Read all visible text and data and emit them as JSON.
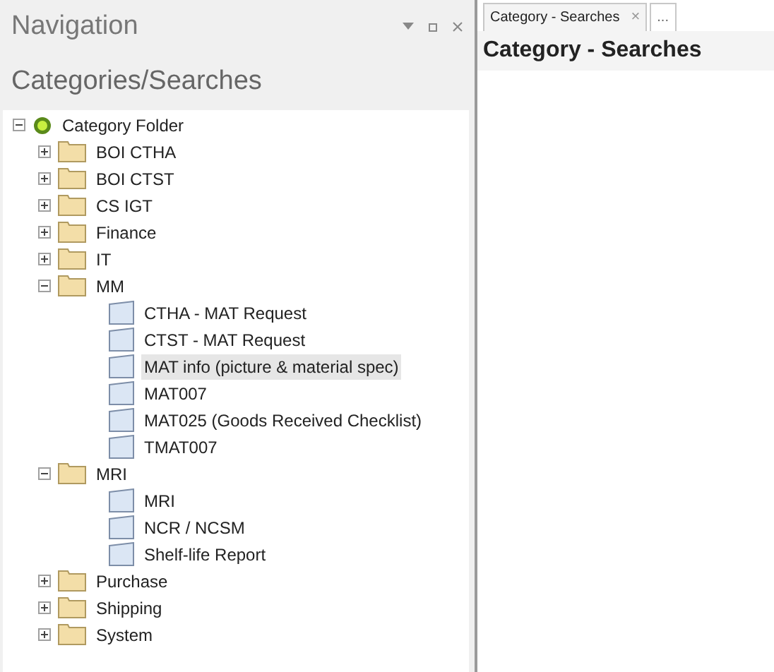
{
  "navigation": {
    "title": "Navigation",
    "subtitle": "Categories/Searches",
    "tree": [
      {
        "label": "Category Folder",
        "kind": "root",
        "expanded": true,
        "selected": false,
        "children": [
          {
            "label": "BOI CTHA",
            "kind": "folder",
            "expanded": false,
            "selected": false
          },
          {
            "label": "BOI CTST",
            "kind": "folder",
            "expanded": false,
            "selected": false
          },
          {
            "label": "CS IGT",
            "kind": "folder",
            "expanded": false,
            "selected": false
          },
          {
            "label": "Finance",
            "kind": "folder",
            "expanded": false,
            "selected": false
          },
          {
            "label": "IT",
            "kind": "folder",
            "expanded": false,
            "selected": false
          },
          {
            "label": "MM",
            "kind": "folder",
            "expanded": true,
            "selected": false,
            "children": [
              {
                "label": "CTHA - MAT Request",
                "kind": "search",
                "selected": false
              },
              {
                "label": "CTST - MAT Request",
                "kind": "search",
                "selected": false
              },
              {
                "label": "MAT info (picture & material spec)",
                "kind": "search",
                "selected": true
              },
              {
                "label": "MAT007",
                "kind": "search",
                "selected": false
              },
              {
                "label": "MAT025 (Goods Received Checklist)",
                "kind": "search",
                "selected": false
              },
              {
                "label": "TMAT007",
                "kind": "search",
                "selected": false
              }
            ]
          },
          {
            "label": "MRI",
            "kind": "folder",
            "expanded": true,
            "selected": false,
            "children": [
              {
                "label": "MRI",
                "kind": "search",
                "selected": false
              },
              {
                "label": "NCR / NCSM",
                "kind": "search",
                "selected": false
              },
              {
                "label": "Shelf-life Report",
                "kind": "search",
                "selected": false
              }
            ]
          },
          {
            "label": "Purchase",
            "kind": "folder",
            "expanded": false,
            "selected": false
          },
          {
            "label": "Shipping",
            "kind": "folder",
            "expanded": false,
            "selected": false
          },
          {
            "label": "System",
            "kind": "folder",
            "expanded": false,
            "selected": false
          }
        ]
      }
    ]
  },
  "tabs": [
    {
      "label": "Category - Searches",
      "close": "×",
      "selected": true
    },
    {
      "label": "...",
      "selected": false
    }
  ],
  "page": {
    "heading": "Category - Searches"
  }
}
